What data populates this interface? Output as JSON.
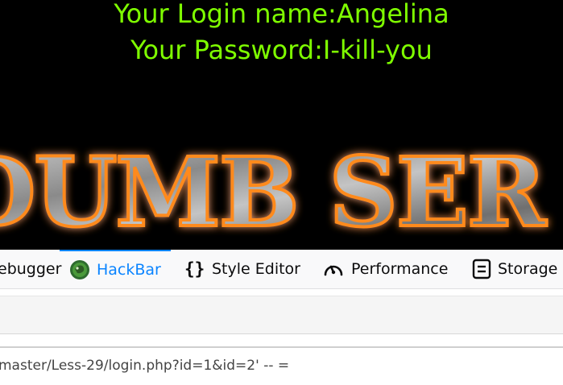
{
  "page": {
    "login_name_line": "Your Login name:Angelina",
    "password_line": "Your Password:I-kill-you",
    "banner_text": "DUMB SER"
  },
  "devtools": {
    "tabs": [
      {
        "label": "ebugger",
        "icon": "debugger-icon",
        "selected": false
      },
      {
        "label": "HackBar",
        "icon": "hackbar-icon",
        "selected": true
      },
      {
        "label": "Style Editor",
        "icon": "style-editor-icon",
        "selected": false
      },
      {
        "label": "Performance",
        "icon": "performance-icon",
        "selected": false
      },
      {
        "label": "Storage",
        "icon": "storage-icon",
        "selected": false
      }
    ]
  },
  "hackbar": {
    "url_value": "master/Less-29/login.php?id=1&id=2' -- ="
  },
  "colors": {
    "accent": "#0a84ff",
    "login_text": "#7fff00",
    "banner_glow": "#ff8a1a"
  }
}
